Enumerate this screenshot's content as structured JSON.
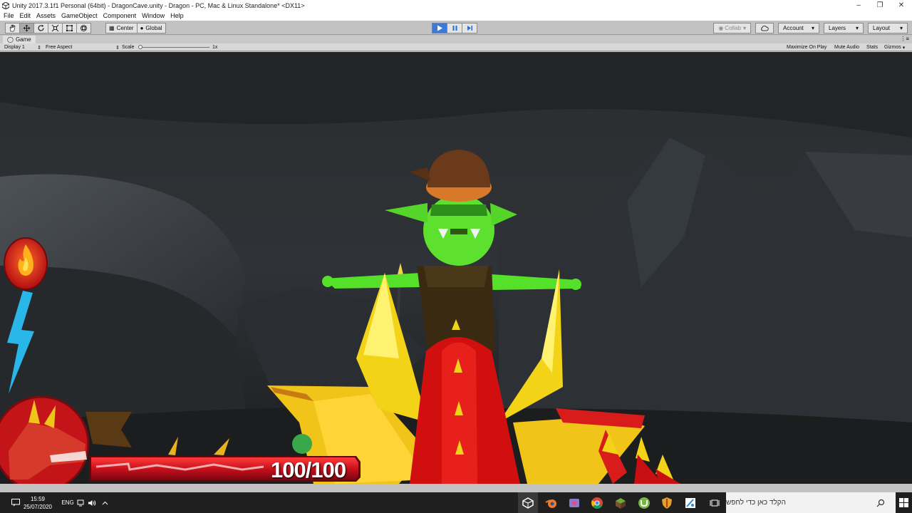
{
  "window": {
    "title": "Unity 2017.3.1f1 Personal (64bit) - DragonCave.unity - Dragon - PC, Mac & Linux Standalone* <DX11>",
    "controls": [
      "minimize-icon",
      "restore-icon",
      "close-icon"
    ]
  },
  "menu": [
    "File",
    "Edit",
    "Assets",
    "GameObject",
    "Component",
    "Window",
    "Help"
  ],
  "toolbar": {
    "tools": [
      "hand-icon",
      "move-icon",
      "rotate-icon",
      "scale-icon",
      "rect-icon",
      "transform-icon"
    ],
    "pivot": "Center",
    "space": "Global",
    "collab": "Collab",
    "account": "Account",
    "layers": "Layers",
    "layout": "Layout"
  },
  "game_tab": {
    "label": "Game",
    "display": "Display 1",
    "aspect": "Free Aspect",
    "scale_label": "Scale",
    "scale_value": "1x",
    "maximize": "Maximize On Play",
    "mute": "Mute Audio",
    "stats": "Stats",
    "gizmos": "Gizmos"
  },
  "game": {
    "health_text": "100/100",
    "health_fraction": 1.0
  },
  "taskbar": {
    "time": "15:59",
    "date": "25/07/2020",
    "language": "ENG",
    "search_placeholder": "הקלד כאן כדי לחפש",
    "pinned_apps": [
      "unity-icon",
      "blender-icon",
      "app-icon",
      "chrome-icon",
      "minecraft-icon",
      "utorrent-icon",
      "shield-icon",
      "paint-icon"
    ]
  }
}
